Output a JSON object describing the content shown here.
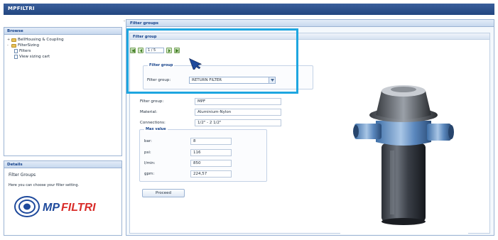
{
  "app": {
    "title": "MPFILTRI"
  },
  "browse": {
    "title": "Browse",
    "tree": [
      {
        "label": "BellHousing & Coupling",
        "kind": "folder",
        "twisty": "+"
      },
      {
        "label": "FilterSizing",
        "kind": "folder",
        "twisty": "-"
      },
      {
        "label": "Filters",
        "kind": "doc",
        "twisty": ""
      },
      {
        "label": "View sizing cart",
        "kind": "doc",
        "twisty": ""
      }
    ]
  },
  "details": {
    "title": "Details",
    "heading": "Filter Groups",
    "text": "Here you can choose your filter setting.",
    "logo_text": "MPFILTRI"
  },
  "main": {
    "title": "Filter groups",
    "inner_title": "Filter group",
    "pager": {
      "value": "1 / 5"
    },
    "group_fieldset": {
      "legend": "Filter group",
      "label": "Filter group:",
      "selected": "RETURN FILTER"
    },
    "info": [
      {
        "label": "Filter group:",
        "value": "MPF"
      },
      {
        "label": "Material:",
        "value": "Aluminium-Nylon"
      },
      {
        "label": "Connections:",
        "value": "1/2\" - 2 1/2\""
      }
    ],
    "max_value": {
      "legend": "Max value",
      "rows": [
        {
          "label": "bar:",
          "value": "8"
        },
        {
          "label": "psi:",
          "value": "116"
        },
        {
          "label": "l/min:",
          "value": "850"
        },
        {
          "label": "gpm:",
          "value": "224,57"
        }
      ]
    },
    "proceed_label": "Proceed"
  },
  "colors": {
    "highlight": "#1ea6e0",
    "title_bar": "#2a4f8a",
    "logo_blue": "#1f4a9c",
    "logo_red": "#d92d2a"
  }
}
